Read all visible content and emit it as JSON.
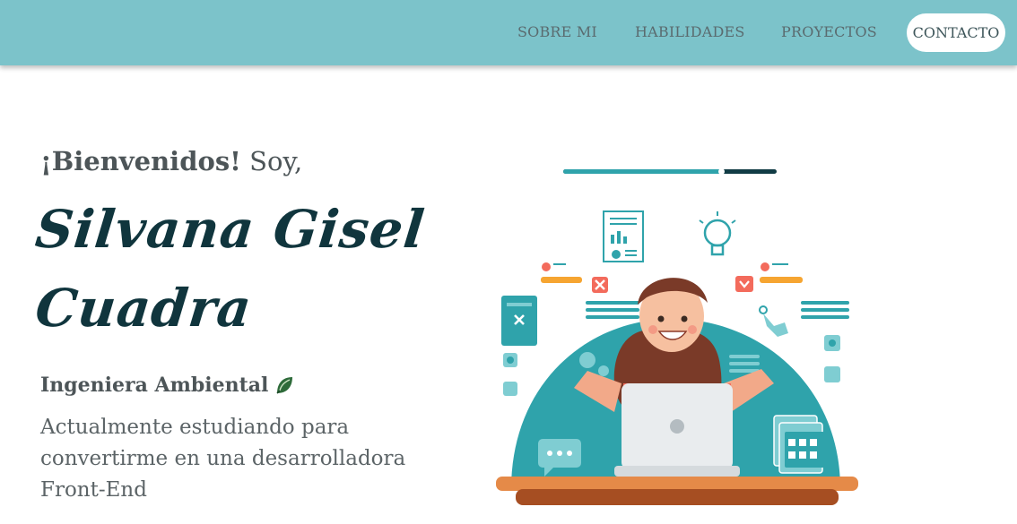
{
  "nav": {
    "items": [
      {
        "label": "SOBRE MI"
      },
      {
        "label": "HABILIDADES"
      },
      {
        "label": "PROYECTOS"
      },
      {
        "label": "CONTACTO"
      }
    ]
  },
  "hero": {
    "welcome_bold": "¡Bienvenidos!",
    "welcome_rest": " Soy,",
    "name_line1": "Silvana Gisel",
    "name_line2": "Cuadra",
    "profession": "Ingeniera Ambiental",
    "profession_icon": "leaf-icon",
    "description": "Actualmente estudiando para convertirme en una desarrolladora Front-End"
  },
  "progress": {
    "value": 0.74
  },
  "colors": {
    "navbar": "#7cc3ca",
    "name": "#10353d",
    "teal": "#2fa3ab",
    "dark_teal": "#113c45"
  }
}
